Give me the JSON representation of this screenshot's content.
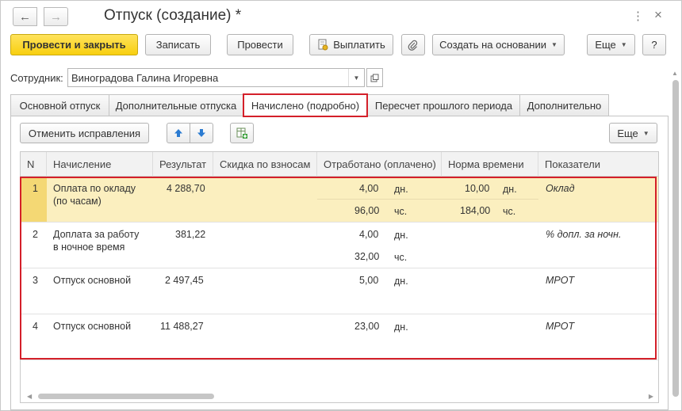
{
  "window": {
    "title": "Отпуск (создание) *",
    "back_icon": "←",
    "forward_icon": "→",
    "more_icon": "⋮",
    "close_icon": "×"
  },
  "toolbar": {
    "post_and_close": "Провести и закрыть",
    "save": "Записать",
    "post": "Провести",
    "pay": "Выплатить",
    "create_based_on": "Создать на основании",
    "more": "Еще",
    "help": "?"
  },
  "employee": {
    "label": "Сотрудник:",
    "value": "Виноградова Галина Игоревна"
  },
  "tabs": [
    {
      "label": "Основной отпуск"
    },
    {
      "label": "Дополнительные отпуска"
    },
    {
      "label": "Начислено (подробно)"
    },
    {
      "label": "Пересчет прошлого периода"
    },
    {
      "label": "Дополнительно"
    }
  ],
  "panel_toolbar": {
    "cancel_corrections": "Отменить исправления",
    "more": "Еще"
  },
  "table": {
    "columns": [
      "N",
      "Начисление",
      "Результат",
      "Скидка по взносам",
      "Отработано (оплачено)",
      "Норма времени",
      "Показатели"
    ],
    "rows": [
      {
        "n": "1",
        "accrual_line1": "Оплата по окладу",
        "accrual_line2": "(по часам)",
        "result": "4 288,70",
        "worked1": "4,00",
        "worked_unit1": "дн.",
        "worked2": "96,00",
        "worked_unit2": "чс.",
        "norm1": "10,00",
        "norm_unit1": "дн.",
        "norm2": "184,00",
        "norm_unit2": "чс.",
        "indicator": "Оклад"
      },
      {
        "n": "2",
        "accrual_line1": "Доплата за работу",
        "accrual_line2": "в ночное время",
        "result": "381,22",
        "worked1": "4,00",
        "worked_unit1": "дн.",
        "worked2": "32,00",
        "worked_unit2": "чс.",
        "indicator": "% допл. за ночн."
      },
      {
        "n": "3",
        "accrual_line1": "Отпуск основной",
        "result": "2 497,45",
        "worked1": "5,00",
        "worked_unit1": "дн.",
        "indicator": "МРОТ"
      },
      {
        "n": "4",
        "accrual_line1": "Отпуск основной",
        "result": "11 488,27",
        "worked1": "23,00",
        "worked_unit1": "дн.",
        "indicator": "МРОТ"
      }
    ]
  }
}
